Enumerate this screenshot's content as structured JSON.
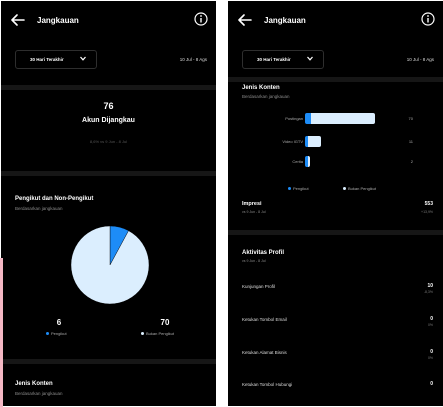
{
  "app": {
    "title": "Jangkauan",
    "back_icon": "back-arrow-icon",
    "info_icon": "info-icon",
    "background": "#000000"
  },
  "filter": {
    "selected": "30 Hari Terakhir",
    "date_range": "10 Jul - 8 Ags"
  },
  "overview": {
    "accounts_reached": "76",
    "accounts_reached_label": "Akun Dijangkau",
    "accounts_reached_sub": "8,6% vs 9 Jun - 8 Jul"
  },
  "followers_section": {
    "title": "Pengikut dan Non-Pengikut",
    "subtitle": "Berdasarkan jangkauan",
    "followers_value": "6",
    "followers_label": "Pengikut",
    "non_followers_value": "70",
    "non_followers_label": "Bukan Pengikut"
  },
  "content_section": {
    "title": "Jenis Konten",
    "subtitle": "Berdasarkan jangkauan",
    "legend_followers": "Pengikut",
    "legend_non_followers": "Bukan Pengikut"
  },
  "chart_data": [
    {
      "type": "pie",
      "title": "",
      "categories": [
        "Pengikut",
        "Bukan Pengikut"
      ],
      "values": [
        6,
        70
      ],
      "colors": [
        "#1d8cf7",
        "#dbeefe"
      ]
    },
    {
      "type": "bar",
      "orientation": "horizontal",
      "stacked": true,
      "categories": [
        "Postingan",
        "Video IGTV",
        "Cerita"
      ],
      "series": [
        {
          "name": "Pengikut",
          "values": [
            5,
            0,
            0
          ],
          "color": "#1d8cf7"
        },
        {
          "name": "Bukan Pengikut",
          "values": [
            55,
            11,
            2
          ],
          "color": "#dbeefe"
        }
      ],
      "value_labels": [
        "70",
        "11",
        "2"
      ],
      "xlim": [
        0,
        70
      ]
    }
  ],
  "impressions": {
    "label": "Impresi",
    "sub": "vs 9 Jun - 8 Jul",
    "value": "553",
    "change": "+13,9%"
  },
  "profile_activity": {
    "title": "Aktivitas Profil",
    "subtitle": "vs 9 Jun - 8 Jul",
    "rows": [
      {
        "label": "Kunjungan Profil",
        "value": "10",
        "change": "-8,3%"
      },
      {
        "label": "Ketukan Tombol Email",
        "value": "0",
        "change": "0%"
      },
      {
        "label": "Ketukan Alamat Bisnis",
        "value": "0",
        "change": "0%"
      },
      {
        "label": "Ketukan Tombol Hubungi",
        "value": "0",
        "change": ""
      }
    ]
  },
  "colors": {
    "accent": "#1d8cf7",
    "light_accent": "#dbeefe",
    "separator": "#161616"
  }
}
